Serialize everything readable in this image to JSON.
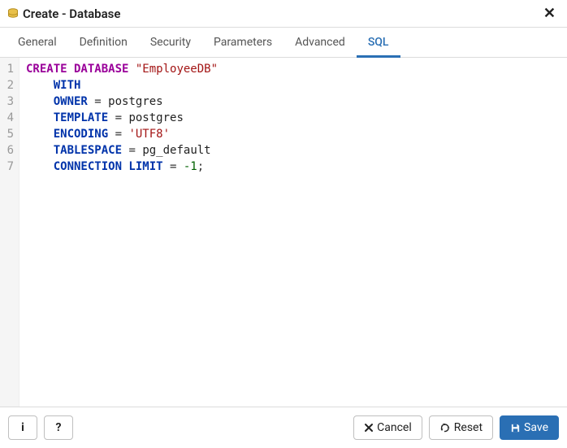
{
  "header": {
    "title": "Create - Database"
  },
  "tabs": [
    {
      "label": "General",
      "active": false
    },
    {
      "label": "Definition",
      "active": false
    },
    {
      "label": "Security",
      "active": false
    },
    {
      "label": "Parameters",
      "active": false
    },
    {
      "label": "Advanced",
      "active": false
    },
    {
      "label": "SQL",
      "active": true
    }
  ],
  "sql": {
    "lines": [
      [
        {
          "t": "CREATE DATABASE",
          "c": "kw"
        },
        {
          "t": " ",
          "c": "punct"
        },
        {
          "t": "\"EmployeeDB\"",
          "c": "str"
        }
      ],
      [
        {
          "t": "    ",
          "c": "punct"
        },
        {
          "t": "WITH",
          "c": "kw2"
        }
      ],
      [
        {
          "t": "    ",
          "c": "punct"
        },
        {
          "t": "OWNER",
          "c": "kw2"
        },
        {
          "t": " = ",
          "c": "punct"
        },
        {
          "t": "postgres",
          "c": "ident"
        }
      ],
      [
        {
          "t": "    ",
          "c": "punct"
        },
        {
          "t": "TEMPLATE",
          "c": "kw2"
        },
        {
          "t": " = ",
          "c": "punct"
        },
        {
          "t": "postgres",
          "c": "ident"
        }
      ],
      [
        {
          "t": "    ",
          "c": "punct"
        },
        {
          "t": "ENCODING",
          "c": "kw2"
        },
        {
          "t": " = ",
          "c": "punct"
        },
        {
          "t": "'UTF8'",
          "c": "str"
        }
      ],
      [
        {
          "t": "    ",
          "c": "punct"
        },
        {
          "t": "TABLESPACE",
          "c": "kw2"
        },
        {
          "t": " = ",
          "c": "punct"
        },
        {
          "t": "pg_default",
          "c": "ident"
        }
      ],
      [
        {
          "t": "    ",
          "c": "punct"
        },
        {
          "t": "CONNECTION LIMIT",
          "c": "kw2"
        },
        {
          "t": " = ",
          "c": "punct"
        },
        {
          "t": "-1",
          "c": "num"
        },
        {
          "t": ";",
          "c": "punct"
        }
      ]
    ]
  },
  "footer": {
    "info_label": "i",
    "help_label": "?",
    "cancel_label": "Cancel",
    "reset_label": "Reset",
    "save_label": "Save"
  }
}
